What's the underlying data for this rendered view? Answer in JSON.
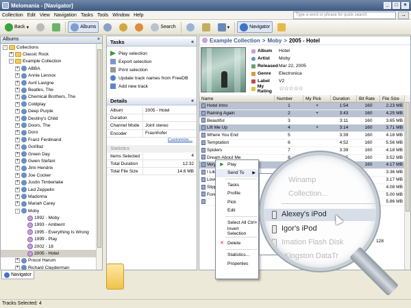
{
  "window": {
    "title": "Melomania - [Navigator]",
    "buttons": [
      "_",
      "□",
      "×"
    ]
  },
  "menu": [
    "Collection",
    "Edit",
    "View",
    "Navigation",
    "Tasks",
    "Tools",
    "Window",
    "Help"
  ],
  "search": {
    "placeholder": "Type a word or phrase for quick search",
    "go": "→"
  },
  "toolbar": {
    "back": "Back",
    "albums": "Albums",
    "search": "Search",
    "navigator": "Navigator"
  },
  "left": {
    "header": "Albums",
    "close": "×",
    "tree": [
      {
        "label": "Collections",
        "level": 0,
        "kind": "folder",
        "exp": "-"
      },
      {
        "label": "Classic Rock",
        "level": 1,
        "kind": "folder",
        "exp": "+"
      },
      {
        "label": "Example Collection",
        "level": 1,
        "kind": "folder",
        "exp": "-"
      },
      {
        "label": "ABBA",
        "level": 2,
        "kind": "person",
        "exp": "+"
      },
      {
        "label": "Annie Lennox",
        "level": 2,
        "kind": "person",
        "exp": "+"
      },
      {
        "label": "Avril Lavigne",
        "level": 2,
        "kind": "person",
        "exp": "+"
      },
      {
        "label": "Beatles, The",
        "level": 2,
        "kind": "person",
        "exp": "+"
      },
      {
        "label": "Chemical Brothers, The",
        "level": 2,
        "kind": "person",
        "exp": "+"
      },
      {
        "label": "Coldplay",
        "level": 2,
        "kind": "person",
        "exp": "+"
      },
      {
        "label": "Deep Purple",
        "level": 2,
        "kind": "person",
        "exp": "+"
      },
      {
        "label": "Destiny's Child",
        "level": 2,
        "kind": "person",
        "exp": "+"
      },
      {
        "label": "Doors, The",
        "level": 2,
        "kind": "person",
        "exp": "+"
      },
      {
        "label": "Doro",
        "level": 2,
        "kind": "person",
        "exp": "+"
      },
      {
        "label": "Franz Ferdinand",
        "level": 2,
        "kind": "person",
        "exp": "+"
      },
      {
        "label": "Gorillaz",
        "level": 2,
        "kind": "person",
        "exp": "+"
      },
      {
        "label": "Green Day",
        "level": 2,
        "kind": "person",
        "exp": "+"
      },
      {
        "label": "Gwen Stefani",
        "level": 2,
        "kind": "person",
        "exp": "+"
      },
      {
        "label": "Jimi Hendrix",
        "level": 2,
        "kind": "person",
        "exp": "+"
      },
      {
        "label": "Joe Cocker",
        "level": 2,
        "kind": "person",
        "exp": "+"
      },
      {
        "label": "Justin Timberlake",
        "level": 2,
        "kind": "person",
        "exp": "+"
      },
      {
        "label": "Led Zeppelin",
        "level": 2,
        "kind": "person",
        "exp": "+"
      },
      {
        "label": "Madonna",
        "level": 2,
        "kind": "person",
        "exp": "+"
      },
      {
        "label": "Mariah Carey",
        "level": 2,
        "kind": "person",
        "exp": "+"
      },
      {
        "label": "Moby",
        "level": 2,
        "kind": "person",
        "exp": "-"
      },
      {
        "label": "1992 - Moby",
        "level": 3,
        "kind": "cd",
        "exp": ""
      },
      {
        "label": "1993 - Ambient",
        "level": 3,
        "kind": "cd",
        "exp": ""
      },
      {
        "label": "1995 - Everything Is Wrong",
        "level": 3,
        "kind": "cd",
        "exp": ""
      },
      {
        "label": "1999 - Play",
        "level": 3,
        "kind": "cd",
        "exp": ""
      },
      {
        "label": "2002 - 18",
        "level": 3,
        "kind": "cd",
        "exp": ""
      },
      {
        "label": "2005 - Hotel",
        "level": 3,
        "kind": "cd",
        "exp": "",
        "selected": true
      },
      {
        "label": "Procol Harum",
        "level": 2,
        "kind": "person",
        "exp": "+"
      },
      {
        "label": "Richard Clayderman",
        "level": 2,
        "kind": "person",
        "exp": "+"
      },
      {
        "label": "Sarah Brightman",
        "level": 2,
        "kind": "person",
        "exp": "+"
      },
      {
        "label": "Sarah Brooks",
        "level": 2,
        "kind": "person",
        "exp": "+"
      }
    ]
  },
  "tasks": {
    "title": "Tasks",
    "items": [
      "Play selection",
      "Export selection",
      "Print selection",
      "Update track names from FreeDB",
      "Add new track"
    ]
  },
  "details": {
    "title": "Details",
    "rows": [
      {
        "k": "Album",
        "v": "2005 - Hotel"
      },
      {
        "k": "Duration",
        "v": ""
      },
      {
        "k": "Channel Mode",
        "v": "Joint stereo"
      },
      {
        "k": "Encoder",
        "v": "Fraunhofer"
      }
    ],
    "customize": "Customize...",
    "stats_title": "Statistics",
    "stats": [
      {
        "k": "Items Selected",
        "v": "4"
      },
      {
        "k": "Total Duration",
        "v": "12:32"
      },
      {
        "k": "Total File Size",
        "v": "14.6 MB"
      }
    ]
  },
  "breadcrumb": [
    "Example Collection",
    ">",
    "Moby",
    ">",
    "2005 - Hotel"
  ],
  "album": {
    "labels": [
      "Album",
      "Artist",
      "Released",
      "Genre",
      "Label",
      "My Rating"
    ],
    "values": [
      "Hotel",
      "Moby",
      "Mar 22, 2005",
      "Electronica",
      "V2",
      "☆☆☆☆☆"
    ]
  },
  "table": {
    "headers": [
      "Name",
      "Number",
      "My Pick",
      "Duration",
      "Bit Rate",
      "File Size"
    ],
    "rows": [
      {
        "name": "Hotel Intro",
        "number": "1",
        "pick": "+",
        "duration": "1:54",
        "bitrate": "160",
        "size": "2.23 MB",
        "hl": true
      },
      {
        "name": "Raining Again",
        "number": "2",
        "pick": "+",
        "duration": "3:43",
        "bitrate": "160",
        "size": "4.25 MB",
        "hl": true
      },
      {
        "name": "Beautiful",
        "number": "3",
        "pick": "",
        "duration": "3:11",
        "bitrate": "160",
        "size": "3.65 MB",
        "hl": false
      },
      {
        "name": "Lift Me Up",
        "number": "4",
        "pick": "+",
        "duration": "3:14",
        "bitrate": "160",
        "size": "3.71 MB",
        "hl": true
      },
      {
        "name": "Where You End",
        "number": "5",
        "pick": "",
        "duration": "3:39",
        "bitrate": "160",
        "size": "4.18 MB",
        "hl": false
      },
      {
        "name": "Temptation",
        "number": "6",
        "pick": "",
        "duration": "4:52",
        "bitrate": "160",
        "size": "5.56 MB",
        "hl": false
      },
      {
        "name": "Spiders",
        "number": "7",
        "pick": "",
        "duration": "3:39",
        "bitrate": "160",
        "size": "4.18 MB",
        "hl": false
      },
      {
        "name": "Dream About Me",
        "number": "8",
        "pick": "",
        "duration": "3:05",
        "bitrate": "160",
        "size": "3.52 MB",
        "hl": false
      },
      {
        "name": "Very",
        "number": "9",
        "pick": "+",
        "duration": "3:39",
        "bitrate": "160",
        "size": "4.17 MB",
        "hl": true
      },
      {
        "name": "I Like",
        "number": "",
        "pick": "",
        "duration": "",
        "bitrate": "",
        "size": "3.36 MB",
        "hl": false
      },
      {
        "name": "Love",
        "number": "",
        "pick": "",
        "duration": "",
        "bitrate": "",
        "size": "3.17 MB",
        "hl": false
      },
      {
        "name": "Slipp",
        "number": "",
        "pick": "",
        "duration": "",
        "bitrate": "",
        "size": "4.08 MB",
        "hl": false
      },
      {
        "name": "Fore",
        "number": "",
        "pick": "",
        "duration": "",
        "bitrate": "",
        "size": "5.00 MB",
        "hl": false
      },
      {
        "name": "",
        "number": "",
        "pick": "",
        "duration": "",
        "bitrate": "",
        "size": "5.86 MB",
        "hl": false
      }
    ],
    "total": "128"
  },
  "context_menu": [
    {
      "icon": "▶",
      "label": "Play",
      "name": "play"
    },
    {
      "icon": "",
      "label": "Send To",
      "name": "send-to",
      "arrow": "▶",
      "active": true
    },
    {
      "sep": true
    },
    {
      "icon": "",
      "label": "Tasks",
      "name": "tasks"
    },
    {
      "icon": "",
      "label": "Profile",
      "name": "profile"
    },
    {
      "icon": "",
      "label": "Pick",
      "name": "pick"
    },
    {
      "icon": "",
      "label": "Edit",
      "name": "edit"
    },
    {
      "sep": true
    },
    {
      "icon": "",
      "label": "Select All  Ctrl+",
      "name": "select-all"
    },
    {
      "icon": "",
      "label": "Invert Selection",
      "name": "invert-selection"
    },
    {
      "sep": true
    },
    {
      "icon": "✕",
      "label": "Delete",
      "name": "delete"
    },
    {
      "sep": true
    },
    {
      "icon": "",
      "label": "Statistics...",
      "name": "statistics"
    },
    {
      "icon": "",
      "label": "Properties",
      "name": "properties"
    }
  ],
  "submenu": [
    "Winamp",
    "Collection...",
    "Alexey's iPod",
    "Igor's iPod",
    "Imation Flash Disk",
    "Kingston DataTr"
  ],
  "bottom_tab": "Navigator",
  "status": "Tracks Selected: 4"
}
